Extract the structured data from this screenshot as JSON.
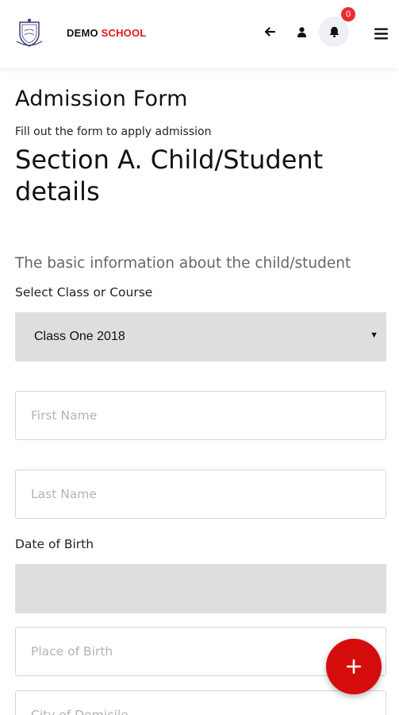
{
  "header": {
    "brand_first": "DEMO",
    "brand_second": "SCHOOL",
    "notification_count": "0",
    "icons": {
      "logo": "school-crest-logo",
      "back": "arrow-left-icon",
      "user": "user-icon",
      "bell": "bell-icon",
      "menu": "hamburger-menu-icon"
    }
  },
  "page": {
    "title": "Admission Form",
    "subtitle": "Fill out the form to apply admission",
    "section_title": "Section A. Child/Student details",
    "section_description": "The basic information about the child/student"
  },
  "form": {
    "class_label": "Select Class or Course",
    "class_selected": "Class One 2018",
    "first_name_placeholder": "First Name",
    "last_name_placeholder": "Last Name",
    "dob_label": "Date of Birth",
    "place_of_birth_placeholder": "Place of Birth",
    "city_of_domicile_placeholder": "City of Domicile"
  },
  "fab": {
    "icon": "plus-icon"
  },
  "colors": {
    "brand_red": "#e8151d",
    "fab_red": "#d50c0c",
    "badge_red": "#ef2b2f",
    "field_gray": "#dedede"
  }
}
